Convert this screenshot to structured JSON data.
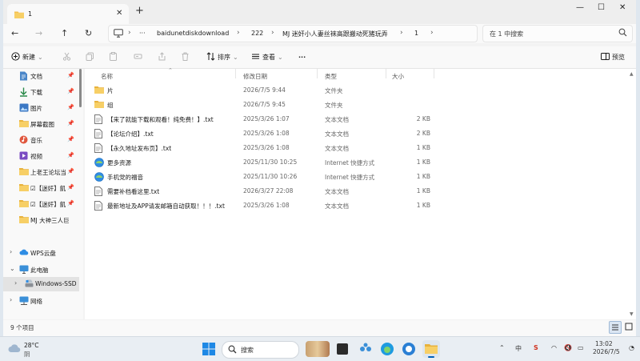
{
  "window": {
    "tab_title": "1",
    "minimize": "—",
    "maximize": "☐",
    "close": "✕",
    "new_tab": "+"
  },
  "nav": {
    "back": "←",
    "forward": "→",
    "up": "↑",
    "refresh": "↻"
  },
  "address": {
    "more": "···",
    "crumbs": [
      "baidunetdiskdownload",
      "222",
      "MJ 迷奸小人妻丝袜高跟搬动死猪玩弄",
      "1"
    ]
  },
  "search": {
    "placeholder": "在 1 中搜索"
  },
  "toolbar": {
    "new_label": "新建",
    "sort_label": "排序",
    "view_label": "查看",
    "more_label": "···",
    "preview_label": "预览"
  },
  "sidebar": {
    "items": [
      {
        "label": "文档",
        "icon": "documents-icon",
        "pinned": true
      },
      {
        "label": "下载",
        "icon": "downloads-icon",
        "pinned": true
      },
      {
        "label": "图片",
        "icon": "pictures-icon",
        "pinned": true
      },
      {
        "label": "屏幕截图",
        "icon": "folder-icon",
        "pinned": true
      },
      {
        "label": "音乐",
        "icon": "music-icon",
        "pinned": true
      },
      {
        "label": "视频",
        "icon": "videos-icon",
        "pinned": true
      },
      {
        "label": "上老王论坛当",
        "icon": "folder-icon",
        "pinned": true
      },
      {
        "label": "☑【迷奸】飢",
        "icon": "folder-icon",
        "pinned": true
      },
      {
        "label": "☑【迷奸】飢",
        "icon": "folder-icon",
        "pinned": true
      },
      {
        "label": "MJ 大神三人巨",
        "icon": "folder-icon",
        "pinned": false
      }
    ],
    "wps": "WPS云盘",
    "this_pc": "此电脑",
    "drive": "Windows-SSD",
    "network": "网络"
  },
  "columns": {
    "name": "名称",
    "date": "修改日期",
    "type": "类型",
    "size": "大小"
  },
  "files": [
    {
      "name": "片",
      "date": "2026/7/5 9:44",
      "type": "文件夹",
      "size": "",
      "icon": "folder-icon"
    },
    {
      "name": "组",
      "date": "2026/7/5 9:45",
      "type": "文件夹",
      "size": "",
      "icon": "folder-icon"
    },
    {
      "name": "【来了就能下载和观看！纯免费！】.txt",
      "date": "2025/3/26 1:07",
      "type": "文本文档",
      "size": "2 KB",
      "icon": "text-file-icon"
    },
    {
      "name": "【论坛介绍】.txt",
      "date": "2025/3/26 1:08",
      "type": "文本文档",
      "size": "2 KB",
      "icon": "text-file-icon"
    },
    {
      "name": "【永久地址发布页】.txt",
      "date": "2025/3/26 1:08",
      "type": "文本文档",
      "size": "1 KB",
      "icon": "text-file-icon"
    },
    {
      "name": "更多资源",
      "date": "2025/11/30 10:25",
      "type": "Internet 快捷方式",
      "size": "1 KB",
      "icon": "internet-shortcut-icon"
    },
    {
      "name": "手机党的福音",
      "date": "2025/11/30 10:26",
      "type": "Internet 快捷方式",
      "size": "1 KB",
      "icon": "internet-shortcut-icon"
    },
    {
      "name": "需要补档看这里.txt",
      "date": "2026/3/27 22:08",
      "type": "文本文档",
      "size": "1 KB",
      "icon": "text-file-icon"
    },
    {
      "name": "最新地址及APP请发邮箱自动获取！！！.txt",
      "date": "2025/3/26 1:08",
      "type": "文本文档",
      "size": "1 KB",
      "icon": "text-file-icon"
    }
  ],
  "status": {
    "count": "9 个项目"
  },
  "taskbar": {
    "temperature": "28°C",
    "weather": "阴",
    "search_label": "搜索",
    "time": "13:02",
    "date": "2026/7/5",
    "ime": "中"
  },
  "colors": {
    "folder": "#f4c04e",
    "accent": "#005fb8",
    "text_file": "#6b6b6b"
  }
}
